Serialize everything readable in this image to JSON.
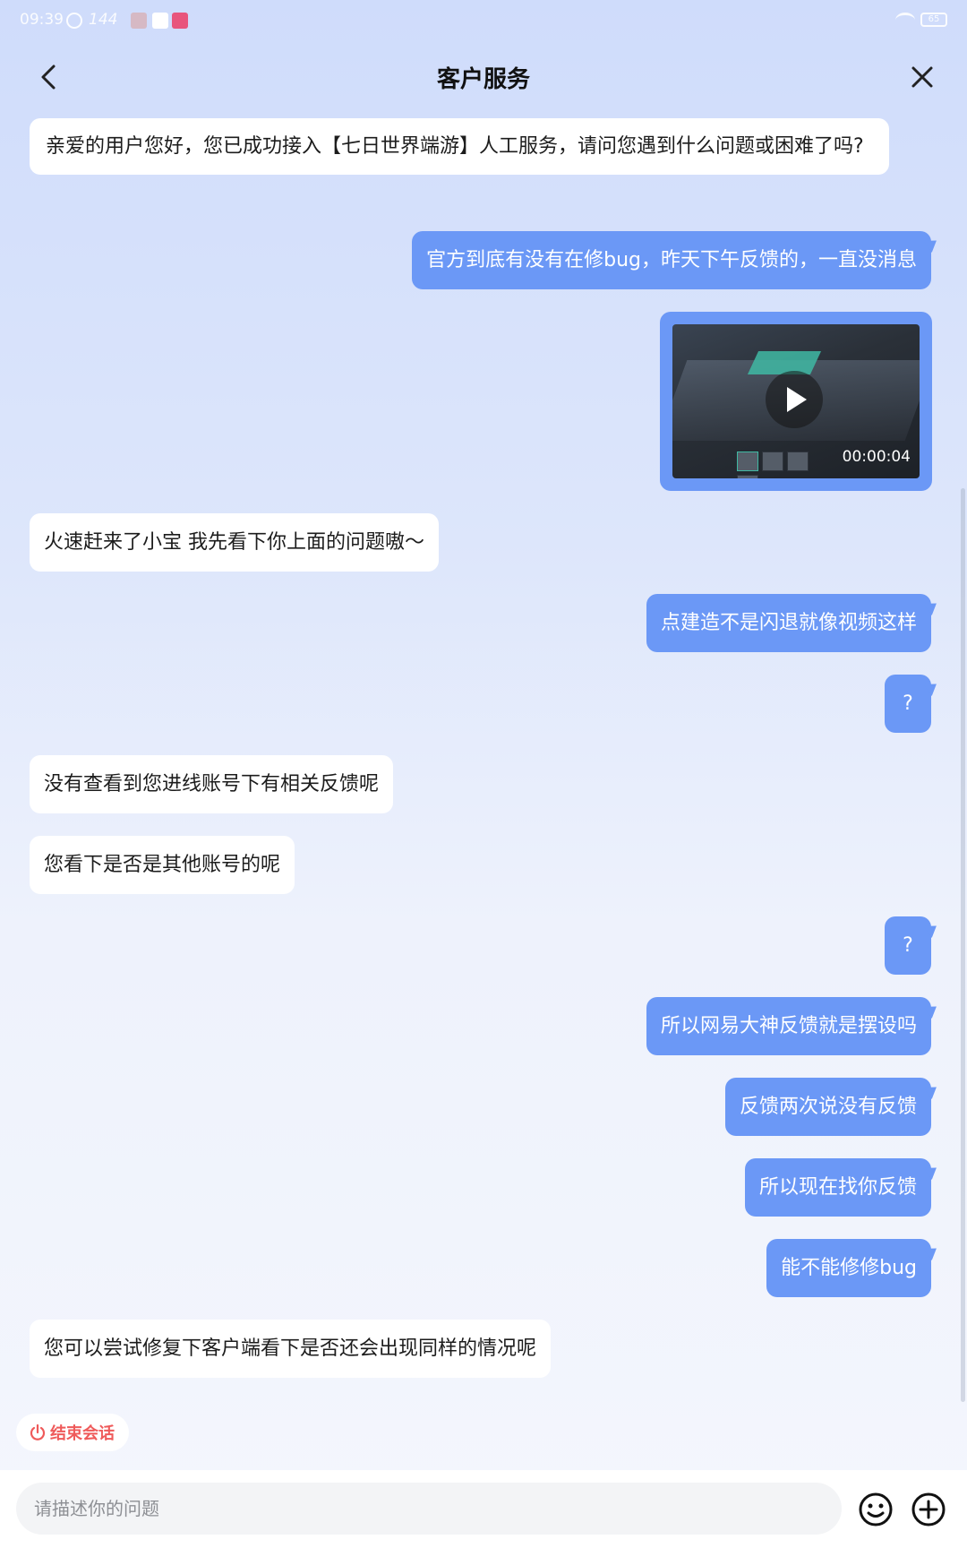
{
  "status_bar": {
    "time": "09:39",
    "refresh_rate": "144",
    "battery": "65"
  },
  "header": {
    "title": "客户服务"
  },
  "messages": [
    {
      "side": "left",
      "text": "亲爱的用户您好，您已成功接入【七日世界端游】人工服务，请问您遇到什么问题或困难了吗?"
    },
    {
      "side": "right",
      "text": "官方到底有没有在修bug，昨天下午反馈的，一直没消息"
    },
    {
      "side": "right",
      "type": "video",
      "duration": "00:00:04"
    },
    {
      "side": "left",
      "text": "火速赶来了小宝 我先看下你上面的问题嗷～"
    },
    {
      "side": "right",
      "text": "点建造不是闪退就像视频这样"
    },
    {
      "side": "right",
      "text": "?"
    },
    {
      "side": "left",
      "text": "没有查看到您进线账号下有相关反馈呢"
    },
    {
      "side": "left",
      "text": "您看下是否是其他账号的呢"
    },
    {
      "side": "right",
      "text": "?"
    },
    {
      "side": "right",
      "text": "所以网易大神反馈就是摆设吗"
    },
    {
      "side": "right",
      "text": "反馈两次说没有反馈"
    },
    {
      "side": "right",
      "text": "所以现在找你反馈"
    },
    {
      "side": "right",
      "text": "能不能修修bug"
    },
    {
      "side": "left",
      "text": "您可以尝试修复下客户端看下是否还会出现同样的情况呢"
    }
  ],
  "end_session": {
    "label": "结束会话"
  },
  "input": {
    "placeholder": "请描述你的问题",
    "value": ""
  },
  "colors": {
    "user_bubble": "#6b98f6",
    "agent_bubble": "#ffffff",
    "end_button_text": "#ef5a5a"
  },
  "icons": {
    "back": "chevron-left-icon",
    "close": "close-icon",
    "emoji": "smiley-icon",
    "plus": "plus-circle-icon",
    "power": "power-icon",
    "play": "play-icon"
  }
}
